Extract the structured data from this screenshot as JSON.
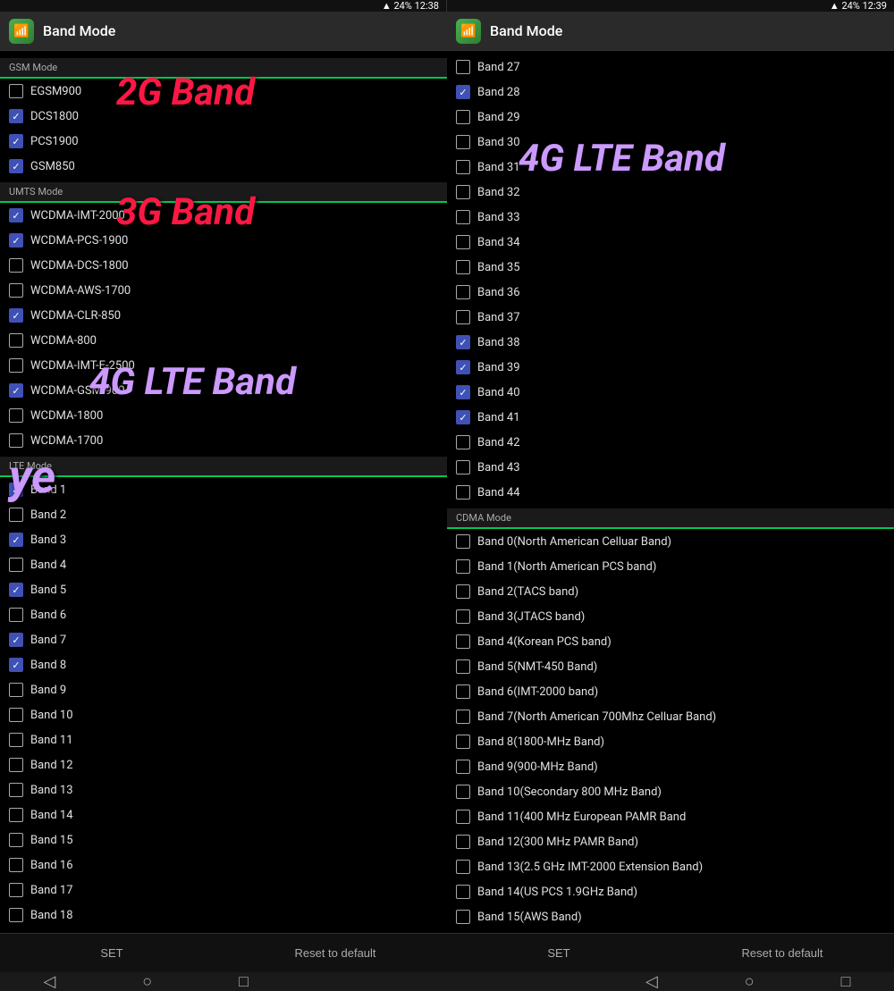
{
  "screens": [
    {
      "id": "left",
      "status": {
        "left": "",
        "right": "▲ 24%  12:38"
      },
      "header": {
        "title": "Band Mode",
        "icon": "📶"
      },
      "overlay_2g": "2G Band",
      "overlay_3g": "3G Band",
      "overlay_4g": "4G LTE Band",
      "overlay_ye": "ye",
      "sections": [
        {
          "label": "GSM Mode",
          "items": [
            {
              "text": "EGSM900",
              "checked": false
            },
            {
              "text": "DCS1800",
              "checked": true
            },
            {
              "text": "PCS1900",
              "checked": true
            },
            {
              "text": "GSM850",
              "checked": true
            }
          ]
        },
        {
          "label": "UMTS Mode",
          "items": [
            {
              "text": "WCDMA-IMT-2000",
              "checked": true
            },
            {
              "text": "WCDMA-PCS-1900",
              "checked": true
            },
            {
              "text": "WCDMA-DCS-1800",
              "checked": false
            },
            {
              "text": "WCDMA-AWS-1700",
              "checked": false
            },
            {
              "text": "WCDMA-CLR-850",
              "checked": true
            },
            {
              "text": "WCDMA-800",
              "checked": false
            },
            {
              "text": "WCDMA-IMT-E-2500",
              "checked": false
            },
            {
              "text": "WCDMA-GSM-900",
              "checked": true
            },
            {
              "text": "WCDMA-1800",
              "checked": false
            },
            {
              "text": "WCDMA-1700",
              "checked": false
            }
          ]
        },
        {
          "label": "LTE Mode",
          "items": [
            {
              "text": "Band 1",
              "checked": true
            },
            {
              "text": "Band 2",
              "checked": false
            },
            {
              "text": "Band 3",
              "checked": true
            },
            {
              "text": "Band 4",
              "checked": false
            },
            {
              "text": "Band 5",
              "checked": true
            },
            {
              "text": "Band 6",
              "checked": false
            },
            {
              "text": "Band 7",
              "checked": true
            },
            {
              "text": "Band 8",
              "checked": true
            },
            {
              "text": "Band 9",
              "checked": false
            },
            {
              "text": "Band 10",
              "checked": false
            },
            {
              "text": "Band 11",
              "checked": false
            },
            {
              "text": "Band 12",
              "checked": false
            },
            {
              "text": "Band 13",
              "checked": false
            },
            {
              "text": "Band 14",
              "checked": false
            },
            {
              "text": "Band 15",
              "checked": false
            },
            {
              "text": "Band 16",
              "checked": false
            },
            {
              "text": "Band 17",
              "checked": false
            },
            {
              "text": "Band 18",
              "checked": false
            }
          ]
        }
      ],
      "buttons": {
        "set": "SET",
        "reset": "Reset to default"
      }
    },
    {
      "id": "right",
      "status": {
        "left": "",
        "right": "▲ 24%  12:39"
      },
      "header": {
        "title": "Band Mode",
        "icon": "📶"
      },
      "overlay_4g": "4G LTE Band",
      "sections": [
        {
          "label": "",
          "items": [
            {
              "text": "Band 27",
              "checked": false
            },
            {
              "text": "Band 28",
              "checked": true
            },
            {
              "text": "Band 29",
              "checked": false
            },
            {
              "text": "Band 30",
              "checked": false
            },
            {
              "text": "Band 31",
              "checked": false
            },
            {
              "text": "Band 32",
              "checked": false
            },
            {
              "text": "Band 33",
              "checked": false
            },
            {
              "text": "Band 34",
              "checked": false
            },
            {
              "text": "Band 35",
              "checked": false
            },
            {
              "text": "Band 36",
              "checked": false
            },
            {
              "text": "Band 37",
              "checked": false
            },
            {
              "text": "Band 38",
              "checked": true
            },
            {
              "text": "Band 39",
              "checked": true
            },
            {
              "text": "Band 40",
              "checked": true
            },
            {
              "text": "Band 41",
              "checked": true
            },
            {
              "text": "Band 42",
              "checked": false
            },
            {
              "text": "Band 43",
              "checked": false
            },
            {
              "text": "Band 44",
              "checked": false
            }
          ]
        },
        {
          "label": "CDMA Mode",
          "items": [
            {
              "text": "Band 0(North American Celluar Band)",
              "checked": false
            },
            {
              "text": "Band 1(North American PCS band)",
              "checked": false
            },
            {
              "text": "Band 2(TACS band)",
              "checked": false
            },
            {
              "text": "Band 3(JTACS band)",
              "checked": false
            },
            {
              "text": "Band 4(Korean PCS band)",
              "checked": false
            },
            {
              "text": "Band 5(NMT-450 Band)",
              "checked": false
            },
            {
              "text": "Band 6(IMT-2000 band)",
              "checked": false
            },
            {
              "text": "Band 7(North American 700Mhz Celluar Band)",
              "checked": false
            },
            {
              "text": "Band 8(1800-MHz Band)",
              "checked": false
            },
            {
              "text": "Band 9(900-MHz Band)",
              "checked": false
            },
            {
              "text": "Band 10(Secondary 800 MHz Band)",
              "checked": false
            },
            {
              "text": "Band 11(400 MHz European PAMR Band",
              "checked": false
            },
            {
              "text": "Band 12(300 MHz PAMR Band)",
              "checked": false
            },
            {
              "text": "Band 13(2.5 GHz IMT-2000 Extension Band)",
              "checked": false
            },
            {
              "text": "Band 14(US PCS 1.9GHz Band)",
              "checked": false
            },
            {
              "text": "Band 15(AWS Band)",
              "checked": false
            }
          ]
        }
      ],
      "buttons": {
        "set": "SET",
        "reset": "Reset to default"
      }
    }
  ],
  "nav": {
    "back": "◁",
    "home": "○",
    "recent": "□"
  }
}
